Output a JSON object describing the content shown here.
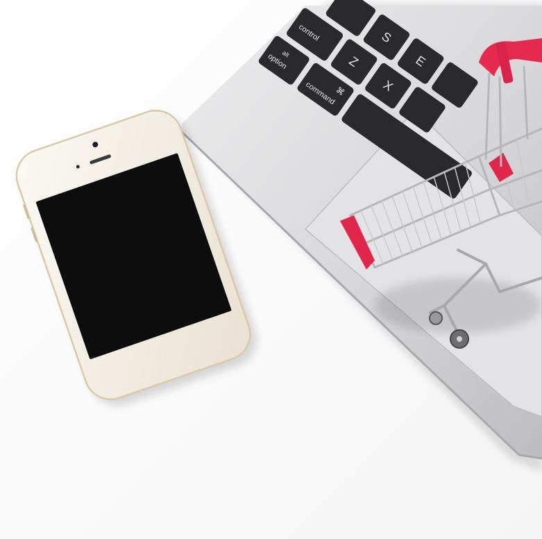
{
  "photo": {
    "background_color": "#fbfbfb",
    "subjects": [
      "smartphone",
      "laptop",
      "shopping-cart"
    ]
  },
  "laptop": {
    "body_color": "#d9d9da",
    "key_color": "#2a2a2c",
    "keys": [
      {
        "label": "control"
      },
      {
        "label": "alt"
      },
      {
        "label": "option"
      },
      {
        "label": "⌘"
      },
      {
        "label": "command"
      },
      {
        "label": "Z"
      },
      {
        "label": "X"
      },
      {
        "label": "S"
      },
      {
        "label": "E"
      }
    ]
  },
  "phone": {
    "body_color": "#f4f0e8",
    "screen_color": "#0d0d0d"
  },
  "cart": {
    "frame_color": "#b9b9bc",
    "accent_color": "#e0264b"
  }
}
